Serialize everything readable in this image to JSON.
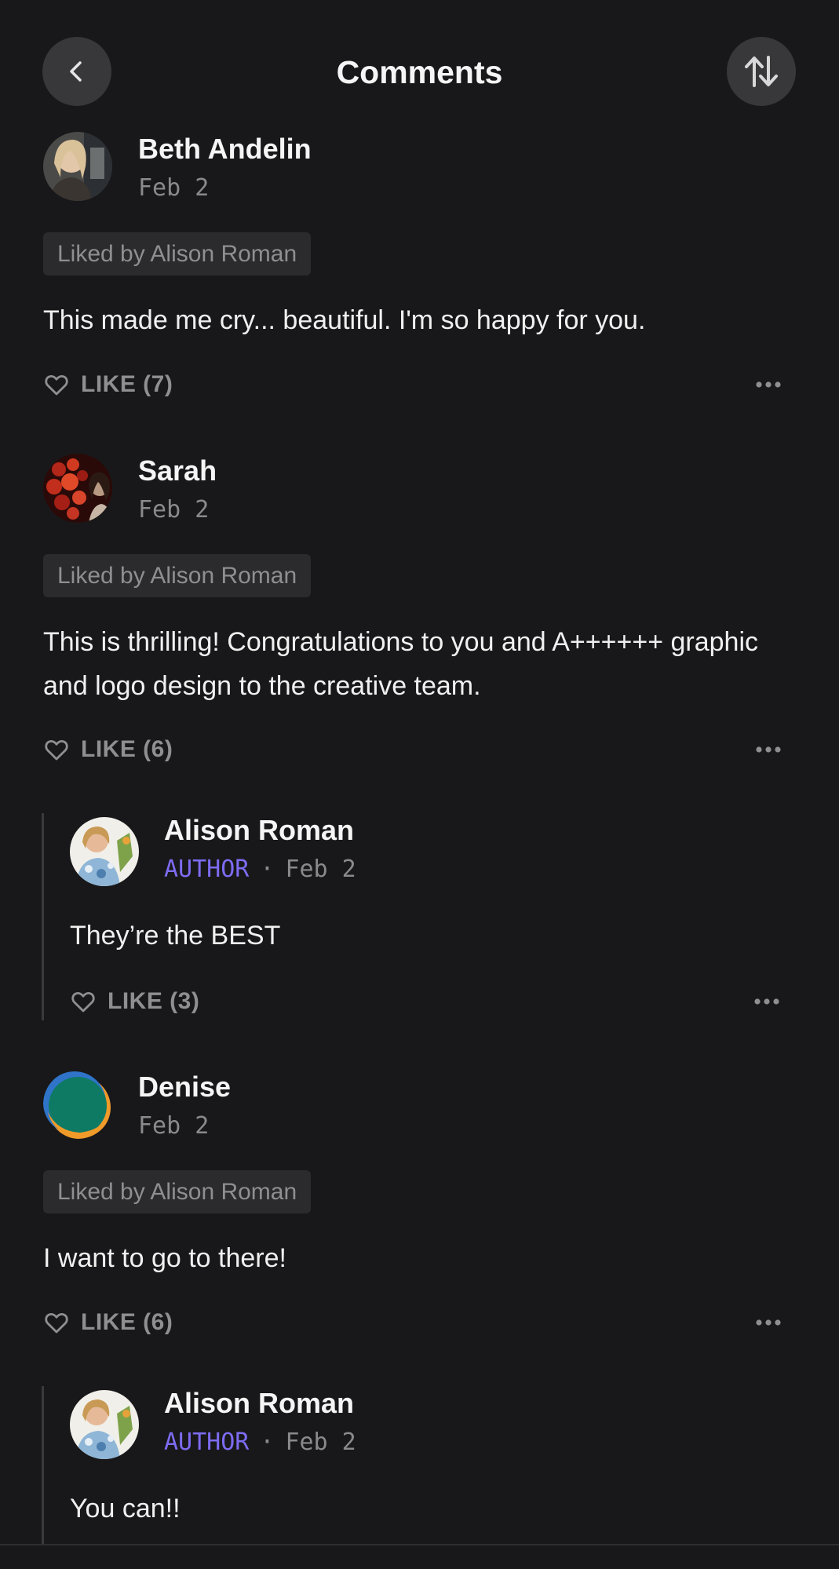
{
  "header": {
    "title": "Comments",
    "back_icon": "chevron-left-icon",
    "sort_icon": "sort-arrows-icon"
  },
  "colors": {
    "background": "#18181a",
    "author_badge": "#7d6cf2",
    "muted_text": "#8f8f92"
  },
  "comments": [
    {
      "author": "Beth Andelin",
      "date": "Feb  2",
      "liked_by": "Liked by Alison Roman",
      "text": "This made me cry... beautiful. I'm so happy for you.",
      "like_label": "LIKE (7)"
    },
    {
      "author": "Sarah",
      "date": "Feb  2",
      "liked_by": "Liked by Alison Roman",
      "text": "This is thrilling! Congratulations to you and A++++++ graphic and logo design to the creative team.",
      "like_label": "LIKE (6)",
      "reply": {
        "author": "Alison Roman",
        "badge": "AUTHOR",
        "separator": "·",
        "date": "Feb  2",
        "text": "They’re the BEST",
        "like_label": "LIKE (3)"
      }
    },
    {
      "author": "Denise",
      "date": "Feb  2",
      "liked_by": "Liked by Alison Roman",
      "text": "I want to go to there!",
      "like_label": "LIKE (6)",
      "reply": {
        "author": "Alison Roman",
        "badge": "AUTHOR",
        "separator": "·",
        "date": "Feb  2",
        "text": "You can!!"
      }
    }
  ]
}
